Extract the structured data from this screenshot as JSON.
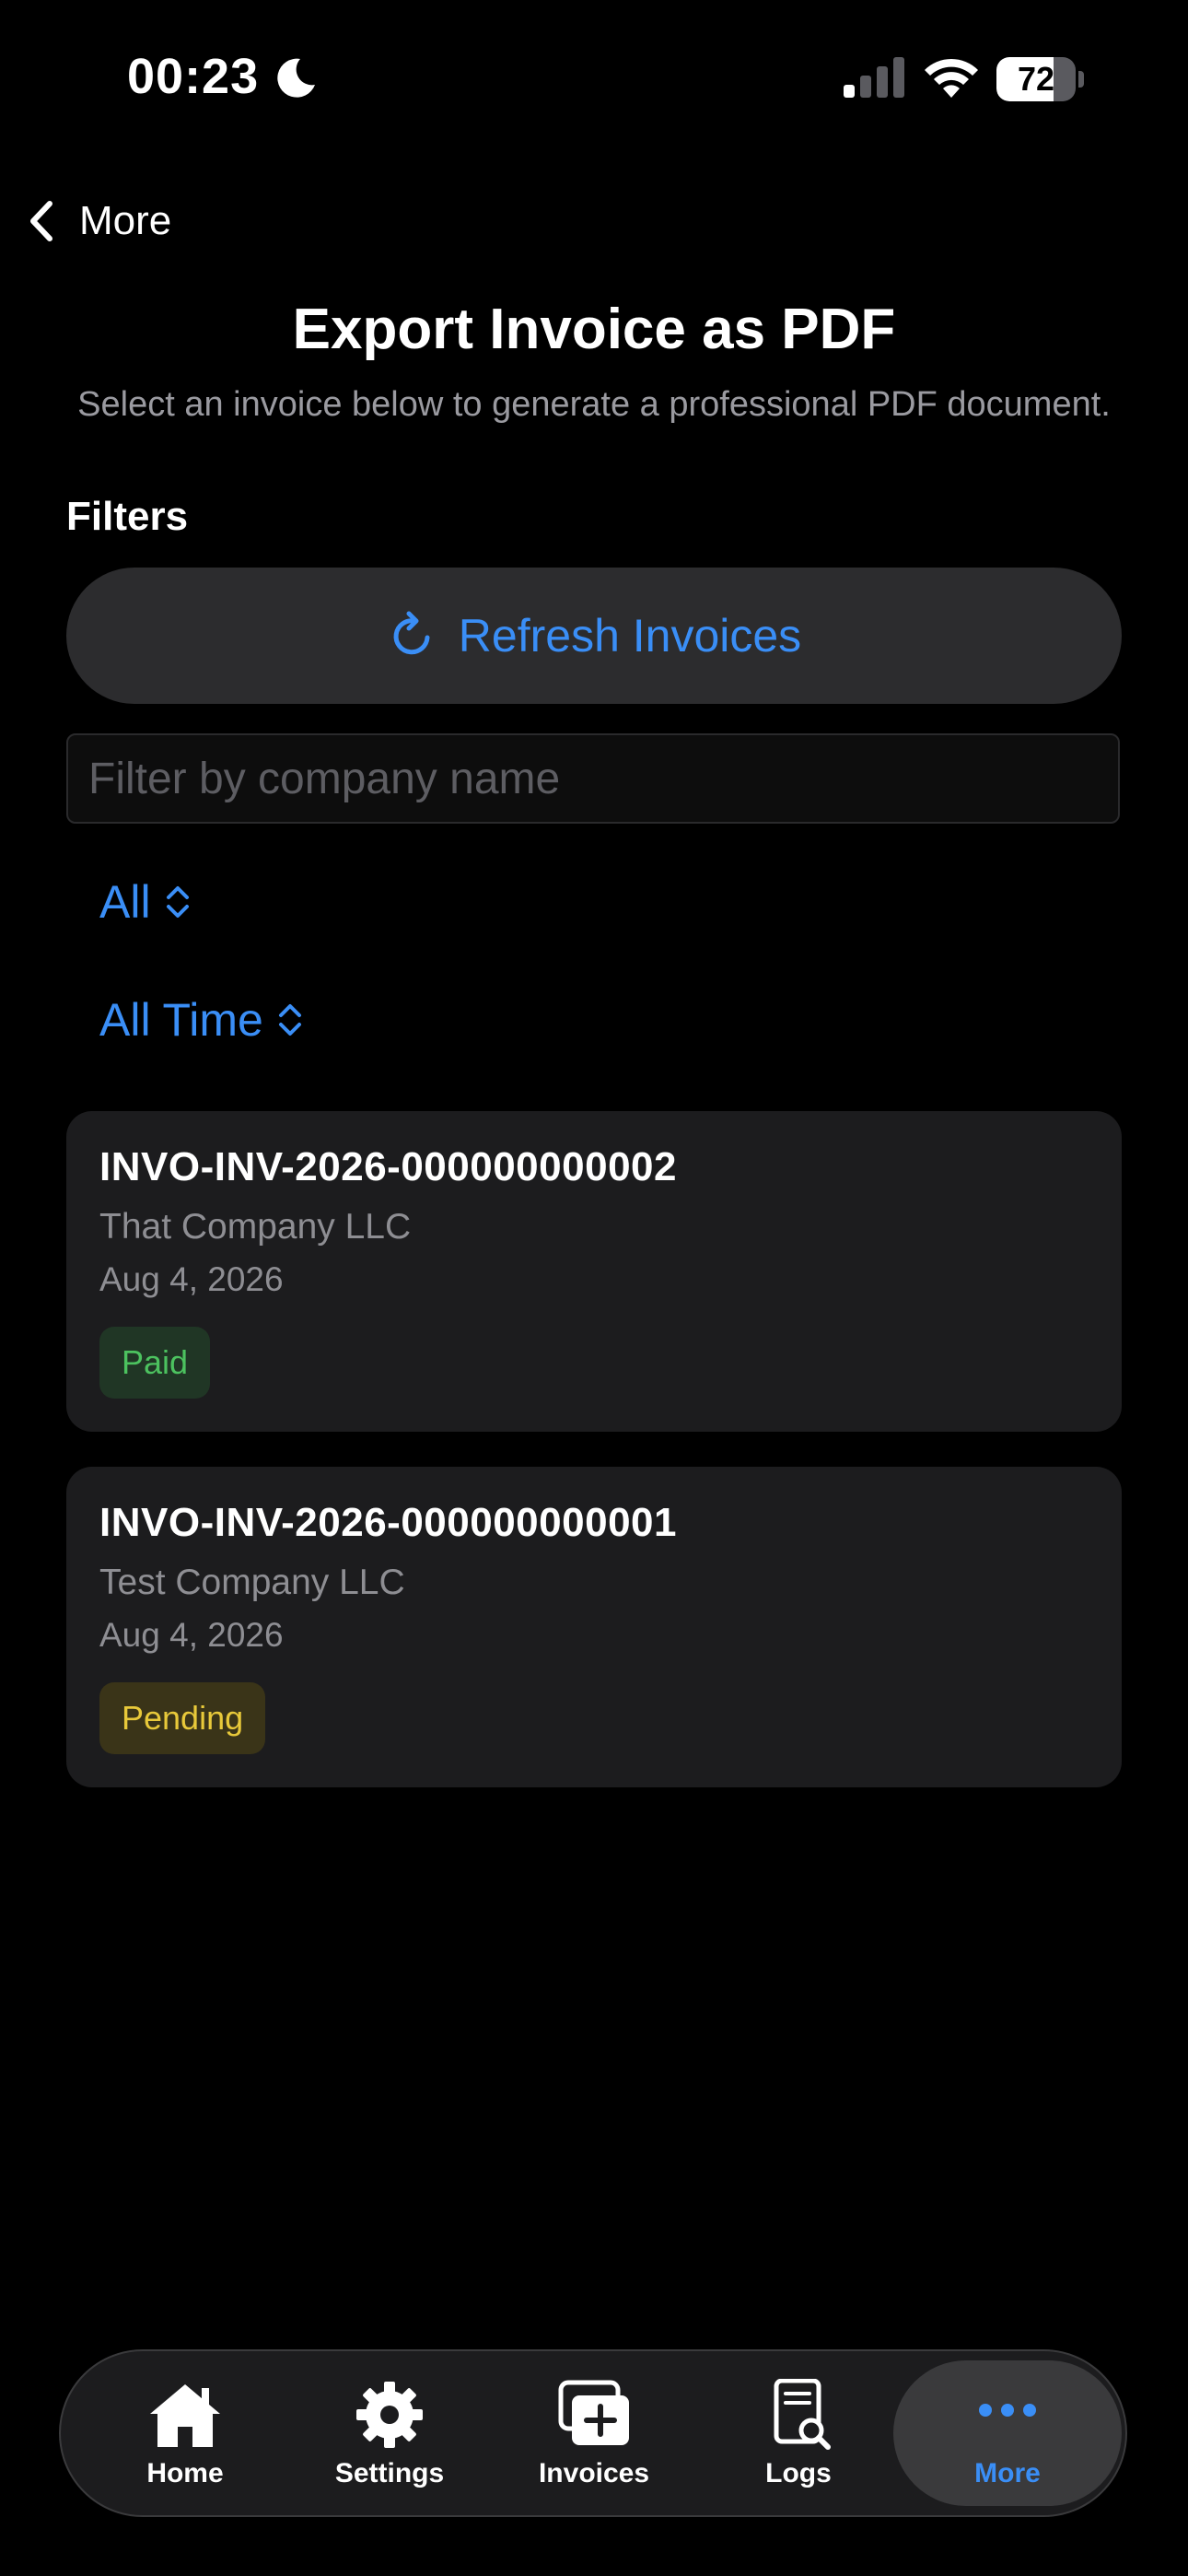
{
  "status_bar": {
    "time": "00:23",
    "battery": "72",
    "battery_level": 0.72
  },
  "nav": {
    "back_label": "More"
  },
  "header": {
    "title": "Export Invoice as PDF",
    "subtitle": "Select an invoice below to generate a professional PDF document."
  },
  "filters": {
    "label": "Filters",
    "refresh_label": "Refresh Invoices",
    "search_placeholder": "Filter by company name",
    "search_value": "",
    "status_selected": "All",
    "time_selected": "All Time"
  },
  "invoices": [
    {
      "id": "INVO-INV-2026-000000000002",
      "company": "That Company LLC",
      "date": "Aug 4, 2026",
      "status": "Paid"
    },
    {
      "id": "INVO-INV-2026-000000000001",
      "company": "Test Company LLC",
      "date": "Aug 4, 2026",
      "status": "Pending"
    }
  ],
  "tabbar": {
    "items": [
      {
        "label": "Home",
        "icon": "house-icon"
      },
      {
        "label": "Settings",
        "icon": "gear-icon"
      },
      {
        "label": "Invoices",
        "icon": "invoice-add-icon"
      },
      {
        "label": "Logs",
        "icon": "document-search-icon"
      },
      {
        "label": "More",
        "icon": "ellipsis-icon"
      }
    ],
    "selected": "More"
  },
  "colors": {
    "accent": "#3a8ef6",
    "background": "#000000",
    "card": "#1c1c1e",
    "paid": "#4cc25f",
    "pending": "#e8c93a"
  }
}
